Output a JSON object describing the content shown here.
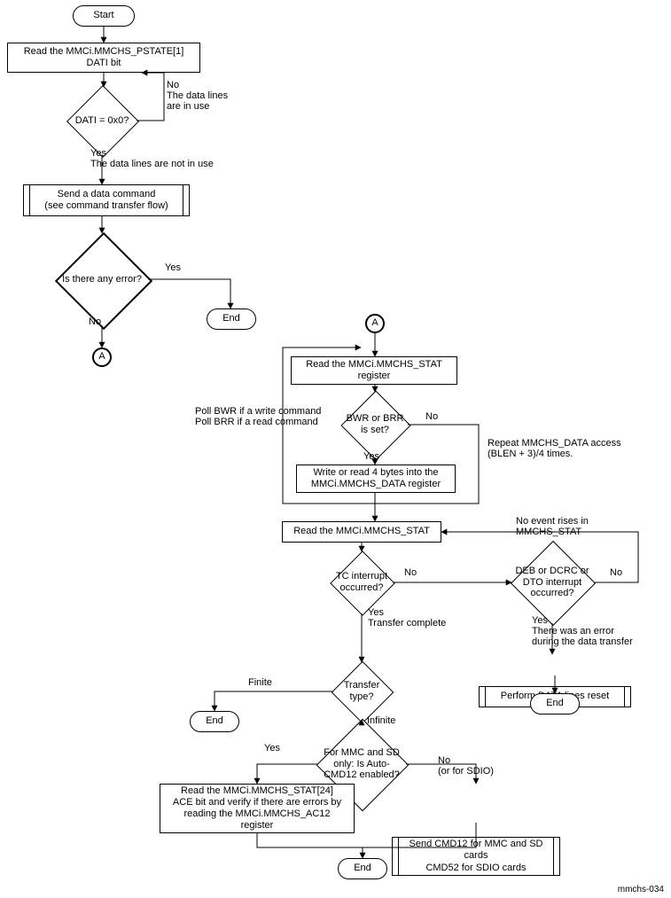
{
  "footer_id": "mmchs-034",
  "terminators": {
    "start": "Start",
    "end1": "End",
    "end2": "End",
    "end3": "End",
    "end4": "End"
  },
  "connectors": {
    "a1": "A",
    "a2": "A"
  },
  "processes": {
    "read_pstate": "Read the MMCi.MMCHS_PSTATE[1]\nDATI bit",
    "send_cmd": "Send a data command\n(see command transfer flow)",
    "read_stat1": "Read the MMCi.MMCHS_STAT\nregister",
    "rw4bytes": "Write or read 4 bytes into the\nMMCi.MMCHS_DATA register",
    "read_stat2": "Read the MMCi.MMCHS_STAT",
    "reset_lines": "Perform DATA lines reset",
    "read_ace": "Read the MMCi.MMCHS_STAT[24]\nACE bit and verify if there are errors by\nreading the MMCi.MMCHS_AC12\nregister",
    "send_cmd12": "Send CMD12 for MMC and SD\ncards\nCMD52 for SDIO cards"
  },
  "decisions": {
    "dati": "DATI = 0x0?",
    "any_error": "Is there any error?",
    "bwr_brr": "BWR or BRR\nis set?",
    "tc_int": "TC interrupt\noccurred?",
    "deb_int": "DEB or\nDCRC or DTO\ninterrupt occurred?",
    "transfer_type": "Transfer type?",
    "auto_cmd12": "For\nMMC and SD only:\nIs Auto-CMD12\nenabled?"
  },
  "labels": {
    "dati_no": "No\nThe data lines\nare in use",
    "dati_yes": "Yes\nThe data lines are not in use",
    "err_yes": "Yes",
    "err_no": "No",
    "poll_note": "Poll BWR if a write command\nPoll BRR if a read command",
    "bwr_no": "No",
    "bwr_yes": "Yes",
    "repeat_note": "Repeat MMCHS_DATA access\n(BLEN + 3)/4 times.",
    "tc_no": "No",
    "tc_yes": "Yes\nTransfer complete",
    "deb_no": "No",
    "deb_yes": "Yes\nThere was an error\nduring the data transfer",
    "no_event": "No event rises in\nMMCHS_STAT",
    "tt_finite": "Finite",
    "tt_infinite": "Infinite",
    "ac_yes": "Yes",
    "ac_no": "No\n(or for SDIO)"
  }
}
